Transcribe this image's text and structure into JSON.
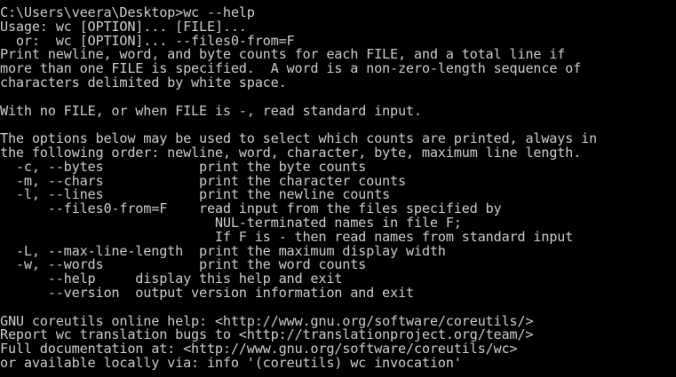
{
  "window": {
    "type": "console",
    "foreground_color": "#cccccc",
    "background_color": "#000000"
  },
  "terminal": {
    "lines": [
      "C:\\Users\\veera\\Desktop>wc --help",
      "Usage: wc [OPTION]... [FILE]...",
      "  or:  wc [OPTION]... --files0-from=F",
      "Print newline, word, and byte counts for each FILE, and a total line if",
      "more than one FILE is specified.  A word is a non-zero-length sequence of",
      "characters delimited by white space.",
      "",
      "With no FILE, or when FILE is -, read standard input.",
      "",
      "The options below may be used to select which counts are printed, always in",
      "the following order: newline, word, character, byte, maximum line length.",
      "  -c, --bytes            print the byte counts",
      "  -m, --chars            print the character counts",
      "  -l, --lines            print the newline counts",
      "      --files0-from=F    read input from the files specified by",
      "                           NUL-terminated names in file F;",
      "                           If F is - then read names from standard input",
      "  -L, --max-line-length  print the maximum display width",
      "  -w, --words            print the word counts",
      "      --help     display this help and exit",
      "      --version  output version information and exit",
      "",
      "GNU coreutils online help: <http://www.gnu.org/software/coreutils/>",
      "Report wc translation bugs to <http://translationproject.org/team/>",
      "Full documentation at: <http://www.gnu.org/software/coreutils/wc>",
      "or available locally via: info '(coreutils) wc invocation'"
    ]
  }
}
